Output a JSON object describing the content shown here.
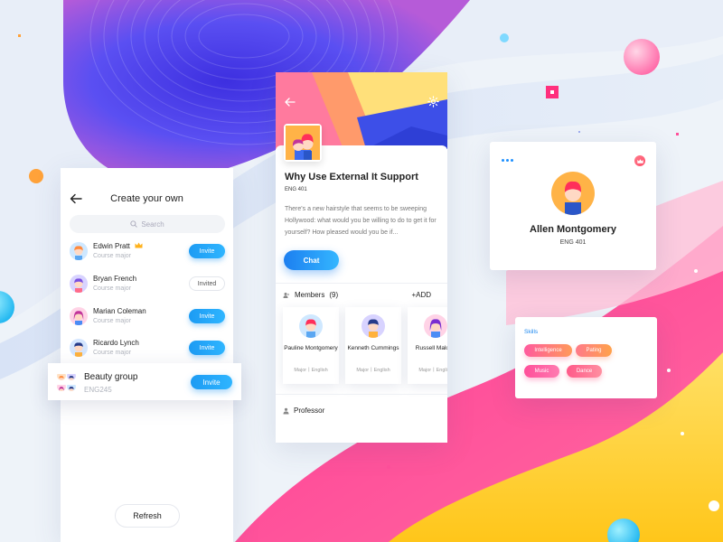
{
  "left_panel": {
    "title": "Create your own",
    "search_placeholder": "Search",
    "rows": [
      {
        "name": "Edwin Pratt",
        "sub": "Course major",
        "action": "Invite"
      },
      {
        "name": "Bryan French",
        "sub": "Course major",
        "action": "Invited"
      },
      {
        "name": "Marian Coleman",
        "sub": "Course major",
        "action": "Invite"
      },
      {
        "name": "Ricardo Lynch",
        "sub": "Course major",
        "action": "Invite"
      }
    ],
    "group": {
      "name": "Beauty group",
      "code": "ENG245",
      "action": "Invite"
    },
    "refresh_label": "Refresh"
  },
  "course_panel": {
    "title": "Why Use External It Support",
    "code": "ENG 401",
    "description": "There's a new hairstyle that seems to be sweeping Hollywood: what would you be willing to do to get it for yourself? How pleased would you be if...",
    "chat_label": "Chat",
    "members_label": "Members",
    "members_count": "(9)",
    "add_label": "+ADD",
    "members": [
      {
        "name": "Pauline Montgomery",
        "major": "Major丨English"
      },
      {
        "name": "Kenneth Cummings",
        "major": "Major丨English"
      },
      {
        "name": "Russell Malone",
        "major": "Major丨English"
      }
    ],
    "professor_label": "Professor"
  },
  "profile": {
    "name": "Allen Montgomery",
    "code": "ENG 401"
  },
  "skills": {
    "title": "Skills",
    "items": [
      "Intelligence",
      "Pating",
      "Music",
      "Dance"
    ]
  },
  "colors": {
    "accent_blue": "#1c9bf3",
    "skill_gradient_start": "#ff5a9e",
    "skill_gradient_end": "#ffa24a",
    "bg_purple": "#5b4ff0",
    "bg_pink": "#ff4f9a",
    "bg_yellow": "#ffd23d"
  }
}
